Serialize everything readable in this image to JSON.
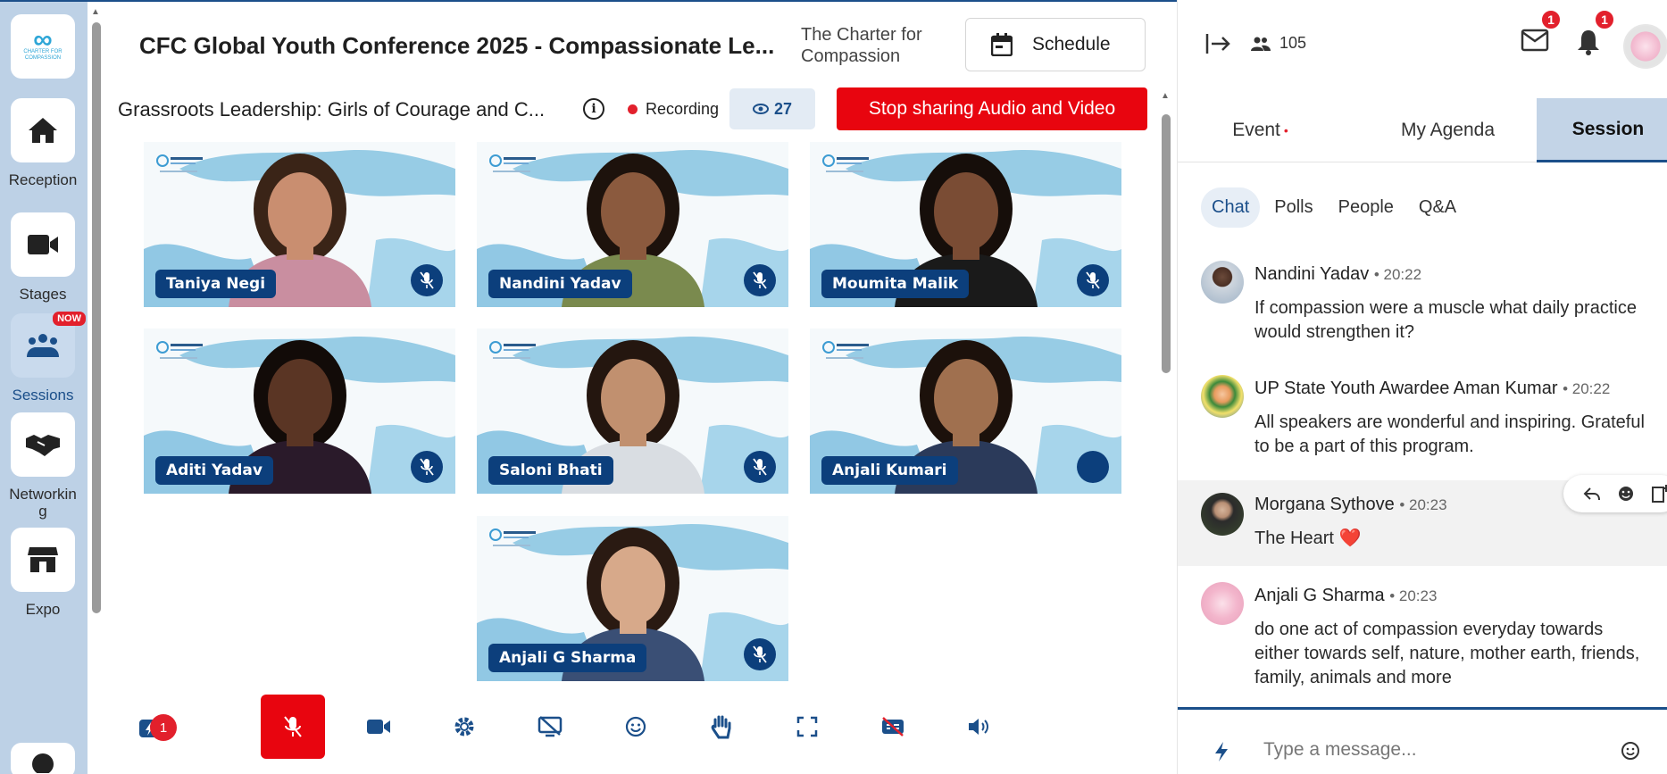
{
  "sidebar": {
    "logo_text": "CHARTER FOR COMPASSION",
    "items": [
      {
        "label": "Reception",
        "icon": "home-icon"
      },
      {
        "label": "Stages",
        "icon": "video-camera-icon"
      },
      {
        "label": "Sessions",
        "icon": "audience-icon",
        "badge": "NOW"
      },
      {
        "label": "Networking",
        "icon": "handshake-icon"
      },
      {
        "label": "Expo",
        "icon": "store-icon"
      }
    ]
  },
  "header": {
    "title": "CFC Global Youth Conference 2025 - Compassionate Le...",
    "org": "The Charter for Compassion",
    "schedule_label": "Schedule"
  },
  "session": {
    "title": "Grassroots Leadership: Girls of Courage and C...",
    "recording_label": "Recording",
    "viewers": "27",
    "stop_label": "Stop sharing Audio and Video"
  },
  "participants": [
    {
      "name": "Taniya Negi",
      "muted": true
    },
    {
      "name": "Nandini Yadav",
      "muted": true
    },
    {
      "name": "Moumita Malik",
      "muted": true
    },
    {
      "name": "Aditi Yadav",
      "muted": true
    },
    {
      "name": "Saloni Bhati",
      "muted": true
    },
    {
      "name": "Anjali Kumari",
      "muted": false,
      "speaking": true
    },
    {
      "name": "Anjali G Sharma",
      "muted": true
    }
  ],
  "toolbar": {
    "notifications_count": "1",
    "buttons": [
      "flash-icon",
      "mic-off-icon",
      "camera-icon",
      "settings-icon",
      "screen-share-off-icon",
      "emoji-icon",
      "raise-hand-icon",
      "fullscreen-icon",
      "captions-off-icon",
      "speaker-icon"
    ]
  },
  "right_panel": {
    "attendees": "105",
    "mail_badge": "1",
    "bell_badge": "1",
    "tabs": [
      {
        "label": "Event",
        "dot": "•"
      },
      {
        "label": "My Agenda"
      },
      {
        "label": "Session",
        "active": true
      }
    ],
    "subtabs": [
      "Chat",
      "Polls",
      "People",
      "Q&A"
    ],
    "messages": [
      {
        "name": "Nandini Yadav",
        "time": "• 20:22",
        "text": "If compassion were a muscle what daily practice would strengthen it?"
      },
      {
        "name": "UP State Youth Awardee Aman Kumar",
        "time": "• 20:22",
        "text": "All speakers are wonderful and inspiring. Grateful to be a part of this program."
      },
      {
        "name": "Morgana Sythove",
        "time": "• 20:23",
        "text": "The Heart",
        "emoji": "❤️"
      },
      {
        "name": "Anjali G Sharma",
        "time": "• 20:23",
        "text": "do one act of compassion everyday towards either towards self, nature, mother earth, friends, family, animals and more"
      }
    ],
    "composer_placeholder": "Type a message..."
  },
  "colors": {
    "brand": "#1b4f8a",
    "stop": "#e8050f",
    "sidebar": "#bdd1e6"
  }
}
